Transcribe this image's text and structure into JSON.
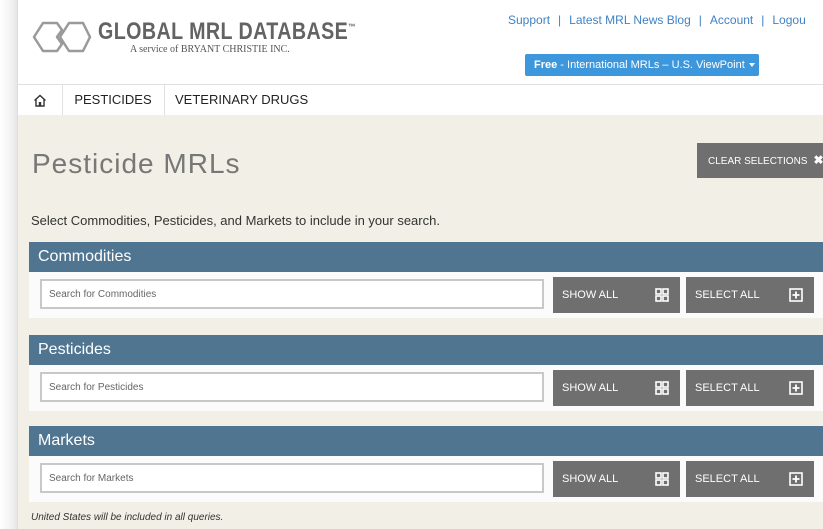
{
  "header": {
    "logo_title": "GLOBAL MRL DATABASE",
    "logo_tm": "™",
    "logo_sub": "A service of BRYANT CHRISTIE INC.",
    "links": [
      "Support",
      "Latest MRL News Blog",
      "Account",
      "Logou"
    ],
    "free_bold": "Free",
    "free_rest": " - International MRLs – U.S. ViewPoint"
  },
  "nav": {
    "home_icon": "home-icon",
    "items": [
      "PESTICIDES",
      "VETERINARY DRUGS"
    ]
  },
  "main": {
    "title": "Pesticide MRLs",
    "clear_label": "CLEAR SELECTIONS",
    "clear_icon": "✖",
    "intro": "Select Commodities, Pesticides, and Markets to include in your search.",
    "sections": [
      {
        "title": "Commodities",
        "placeholder": "Search for Commodities",
        "show_all": "SHOW ALL",
        "select_all": "SELECT ALL"
      },
      {
        "title": "Pesticides",
        "placeholder": "Search for Pesticides",
        "show_all": "SHOW ALL",
        "select_all": "SELECT ALL"
      },
      {
        "title": "Markets",
        "placeholder": "Search for Markets",
        "show_all": "SHOW ALL",
        "select_all": "SELECT ALL"
      }
    ],
    "footnote": "United States will be included in all queries."
  },
  "colors": {
    "section_header": "#4f7591",
    "button_gray": "#6f6f6f",
    "link_blue": "#3f82c4",
    "free_button": "#3d97dc",
    "content_bg": "#f1efe6"
  }
}
